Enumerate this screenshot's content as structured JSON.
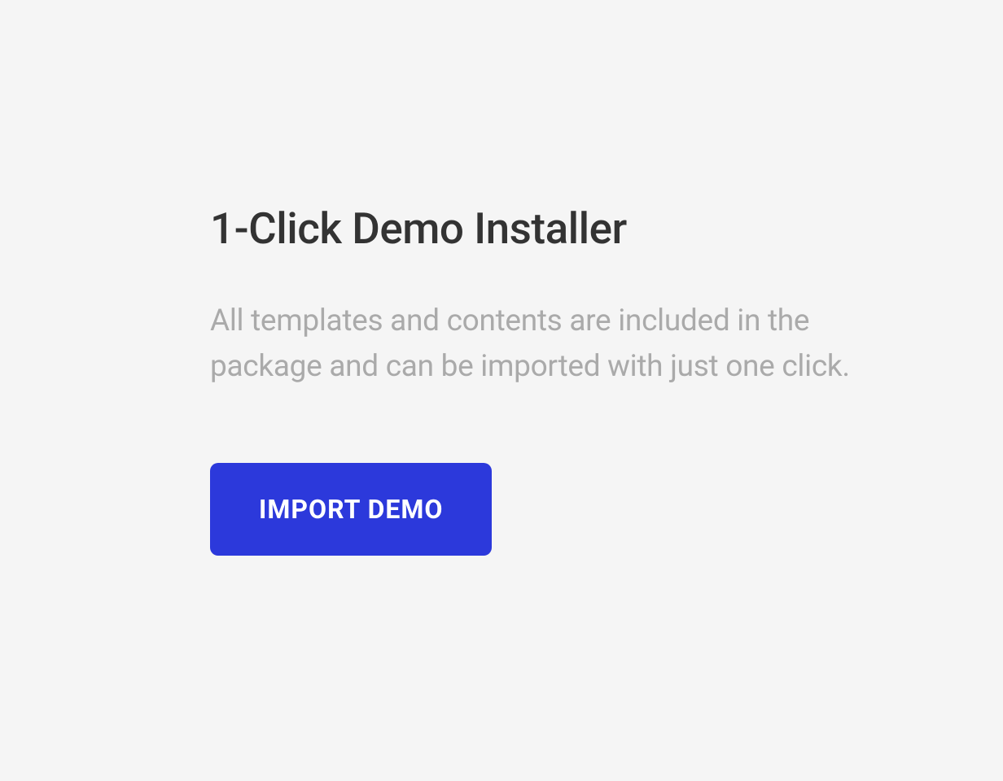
{
  "heading": "1-Click Demo Installer",
  "description": "All templates and contents are included in the package and can be imported with just one click.",
  "button_label": "IMPORT DEMO"
}
